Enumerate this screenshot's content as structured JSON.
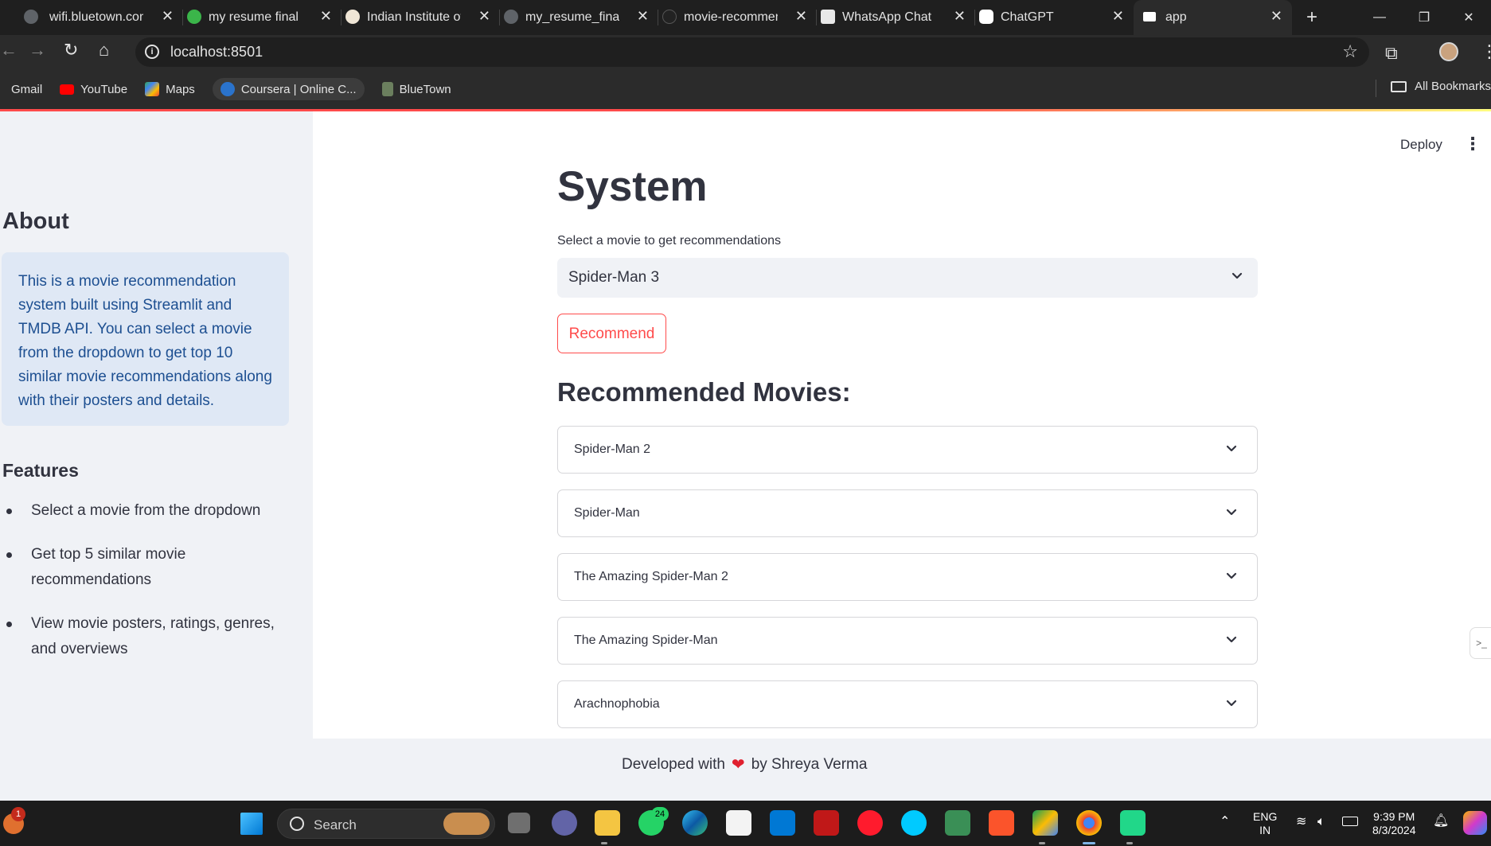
{
  "browser": {
    "tabs": [
      {
        "label": "wifi.bluetown.com"
      },
      {
        "label": "my resume final"
      },
      {
        "label": "Indian Institute of"
      },
      {
        "label": "my_resume_final"
      },
      {
        "label": "movie-recommender"
      },
      {
        "label": "WhatsApp Chat"
      },
      {
        "label": "ChatGPT"
      },
      {
        "label": "app"
      }
    ],
    "url": "localhost:8501",
    "bookmarks": [
      "Gmail",
      "YouTube",
      "Maps",
      "Coursera | Online C...",
      "BlueTown"
    ],
    "all_bookmarks": "All Bookmarks"
  },
  "sidebar": {
    "about_title": "About",
    "about_text": "This is a movie recommendation system built using Streamlit and TMDB API. You can select a movie from the dropdown to get top 10 similar movie recommendations along with their posters and details.",
    "features_title": "Features",
    "features": [
      "Select a movie from the dropdown",
      "Get top 5 similar movie recommendations",
      "View movie posters, ratings, genres, and overviews"
    ]
  },
  "main": {
    "deploy_label": "Deploy",
    "title": "System",
    "select_label": "Select a movie to get recommendations",
    "selected_movie": "Spider-Man 3",
    "recommend_button": "Recommend",
    "recommended_heading": "Recommended Movies:",
    "recommendations": [
      "Spider-Man 2",
      "Spider-Man",
      "The Amazing Spider-Man 2",
      "The Amazing Spider-Man",
      "Arachnophobia"
    ]
  },
  "footer": {
    "prefix": "Developed with",
    "suffix": "by Shreya Verma"
  },
  "taskbar": {
    "search_placeholder": "Search",
    "language_line1": "ENG",
    "language_line2": "IN",
    "time": "9:39 PM",
    "date": "8/3/2024",
    "whatsapp_badge": "24",
    "notification_badge": "1"
  },
  "colors": {
    "accent": "#ff4b4b",
    "sidebar_bg": "#f0f2f6",
    "info_bg": "#dfe8f5",
    "info_text": "#1d4f91",
    "text": "#31333f"
  }
}
